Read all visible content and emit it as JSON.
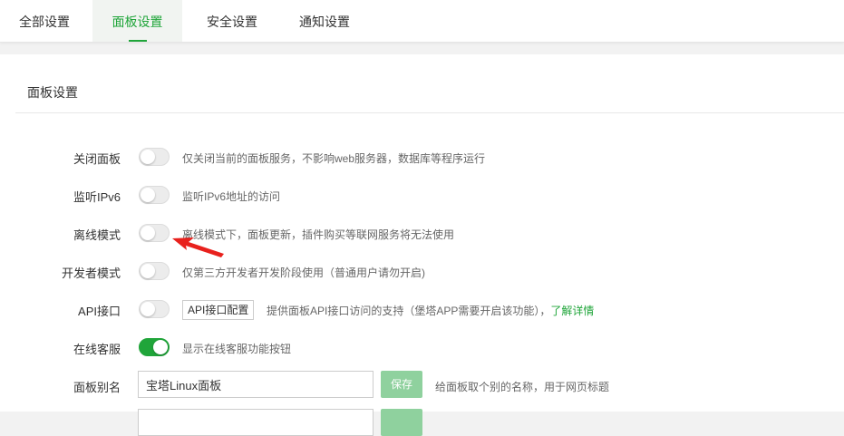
{
  "tabs": [
    {
      "label": "全部设置",
      "active": false
    },
    {
      "label": "面板设置",
      "active": true
    },
    {
      "label": "安全设置",
      "active": false
    },
    {
      "label": "通知设置",
      "active": false
    }
  ],
  "panel": {
    "title": "面板设置",
    "rows": {
      "close_panel": {
        "label": "关闭面板",
        "on": false,
        "desc": "仅关闭当前的面板服务，不影响web服务器，数据库等程序运行"
      },
      "ipv6": {
        "label": "监听IPv6",
        "on": false,
        "desc": "监听IPv6地址的访问"
      },
      "offline": {
        "label": "离线模式",
        "on": false,
        "desc": "离线模式下，面板更新，插件购买等联网服务将无法使用"
      },
      "developer": {
        "label": "开发者模式",
        "on": false,
        "desc": "仅第三方开发者开发阶段使用（普通用户请勿开启)"
      },
      "api": {
        "label": "API接口",
        "on": false,
        "button": "API接口配置",
        "desc": "提供面板API接口访问的支持（堡塔APP需要开启该功能），",
        "link": "了解详情"
      },
      "online_service": {
        "label": "在线客服",
        "on": true,
        "desc": "显示在线客服功能按钮"
      },
      "alias": {
        "label": "面板别名",
        "value": "宝塔Linux面板",
        "save": "保存",
        "desc": "给面板取个别的名称，用于网页标题"
      }
    }
  },
  "colors": {
    "accent": "#20a53a",
    "annotation_arrow": "#e8211d"
  },
  "icons": {
    "annotation": "red-arrow-icon"
  }
}
